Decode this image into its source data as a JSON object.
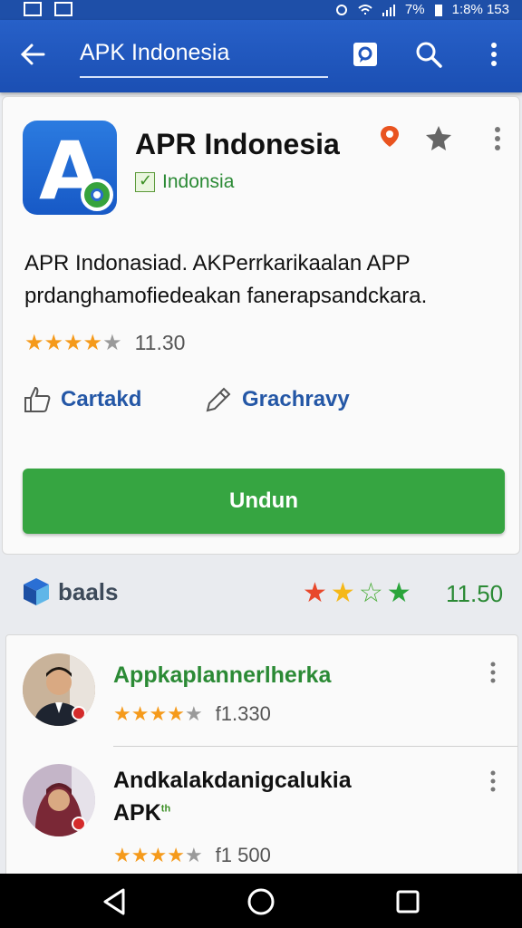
{
  "status_bar": {
    "battery": "7%",
    "time": "1:8% 153"
  },
  "app_bar": {
    "title": "APK Indonesia",
    "back_icon": "back-arrow-icon",
    "actions": [
      "chat-icon",
      "search-icon",
      "more-vert-icon"
    ]
  },
  "app": {
    "name": "APR Indonesia",
    "developer": "Indonsia",
    "description": "APR Indonasiad. AKPerrkarikaalan APP prdanghamofiedeakan fanerapsandckara.",
    "rating_stars": 4,
    "rating_value": "11.30",
    "link_1": "Cartakd",
    "link_2": "Grachravy",
    "install_label": "Undun"
  },
  "summary": {
    "brand": "baals",
    "rating_value": "11.50",
    "star_colors": [
      "#e8482b",
      "#f5b818",
      "#4cae3a",
      "#2aa53b"
    ]
  },
  "list": [
    {
      "title": "Appkaplannerlherka",
      "title_color": "#2b8a35",
      "stars": 4,
      "value": "f1.330"
    },
    {
      "title": "Andkalakdanigcalukia",
      "subtitle": "APK",
      "sup": "th",
      "stars": 4,
      "value": "f1 500"
    }
  ],
  "colors": {
    "app_bar": "#1f56bd",
    "install": "#36a541",
    "link": "#2457a6",
    "developer": "#2b8a35"
  }
}
